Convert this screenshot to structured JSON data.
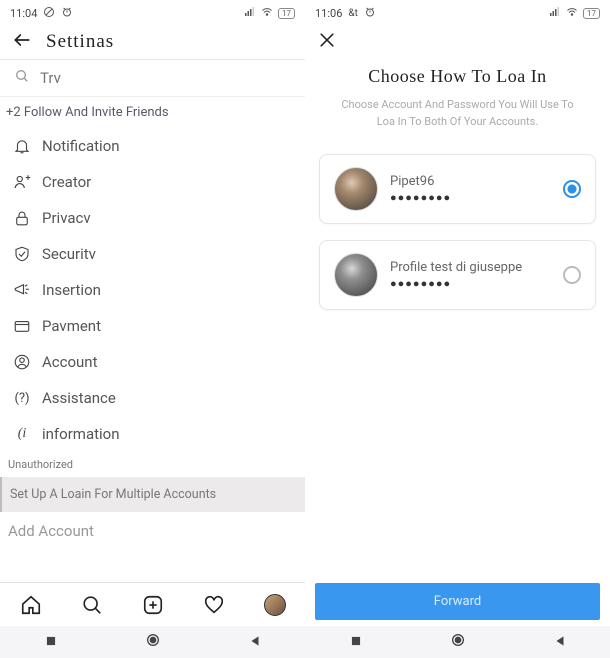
{
  "left": {
    "status": {
      "time": "11:04",
      "battery": "17"
    },
    "header": {
      "title": "Settinas"
    },
    "search": {
      "placeholder": "Trv"
    },
    "invite_link": "+2 Follow And Invite Friends",
    "items": [
      {
        "label": "Notification"
      },
      {
        "label": "Creator"
      },
      {
        "label": "Privacv"
      },
      {
        "label": "Securitv"
      },
      {
        "label": "Insertion"
      },
      {
        "label": "Pavment"
      },
      {
        "label": "Account"
      },
      {
        "label": "Assistance"
      },
      {
        "label": "information"
      }
    ],
    "section_label": "Unauthorized",
    "multi_login": "Set Up A Loain For Multiple Accounts",
    "add_account": "Add Account"
  },
  "right": {
    "status": {
      "time": "11:06",
      "battery": "17"
    },
    "title": "Choose How To Loa In",
    "subtitle1": "Choose Account And Password You Will Use To",
    "subtitle2": "Loa In To Both Of Your Accounts.",
    "accounts": [
      {
        "name": "Pipet96",
        "mask": "●●●●●●●●"
      },
      {
        "name": "Profile test di giuseppe",
        "mask": "●●●●●●●●"
      }
    ],
    "forward": "Forward"
  }
}
